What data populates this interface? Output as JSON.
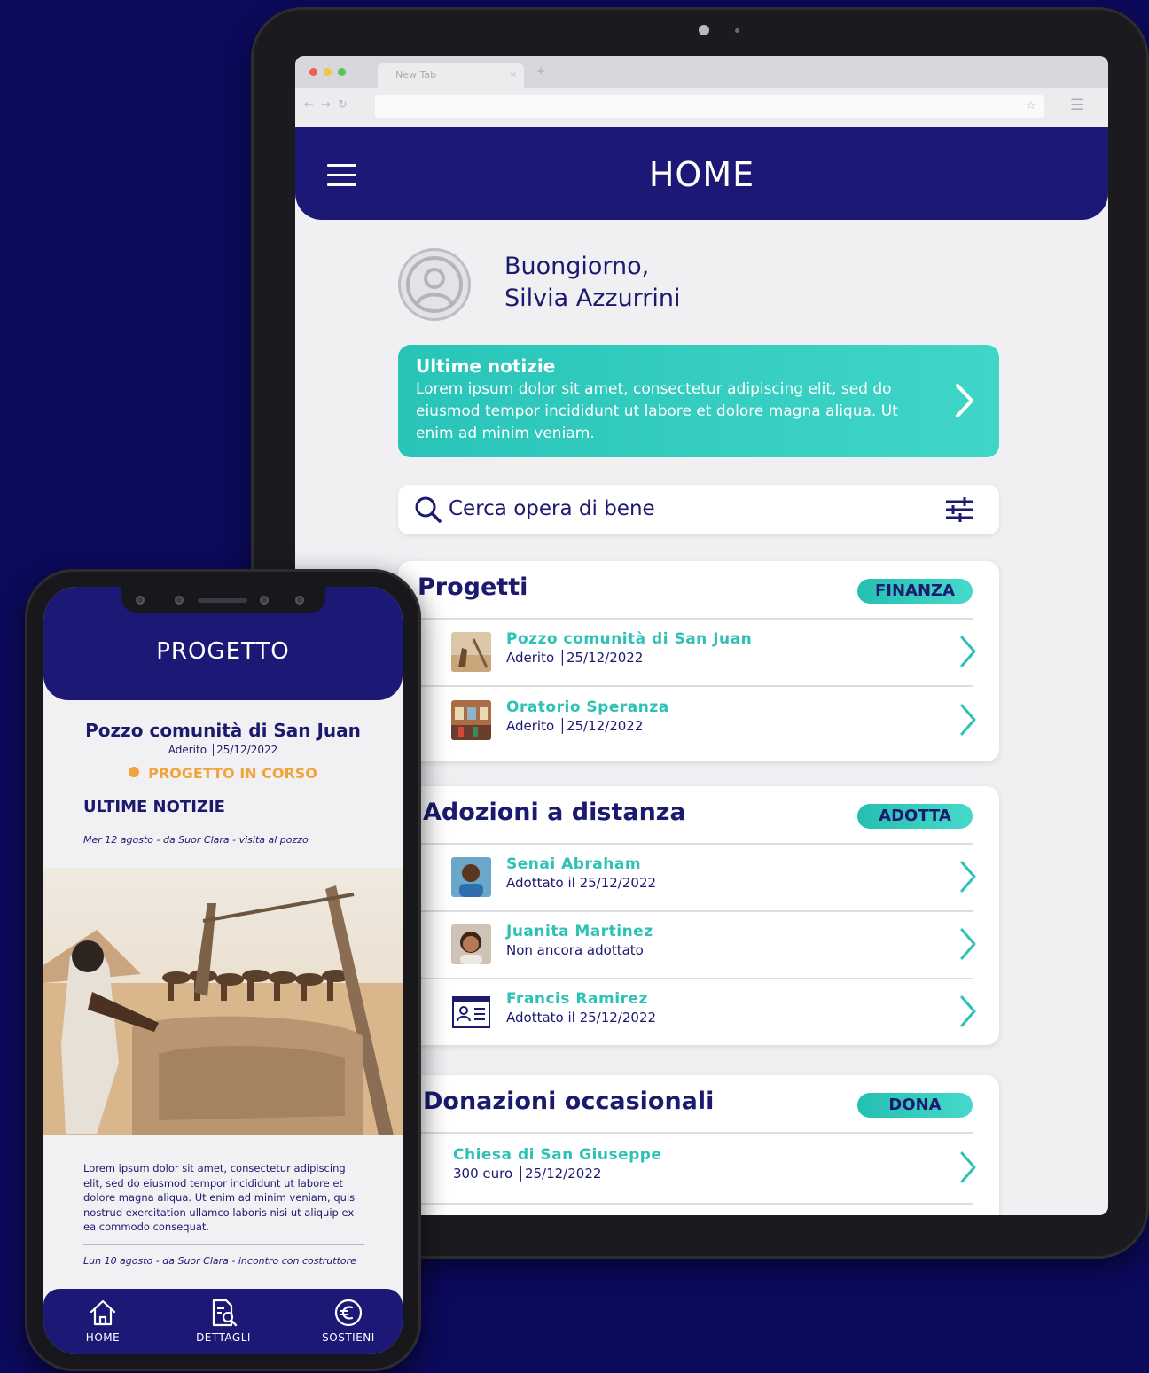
{
  "tablet": {
    "browser": {
      "tab_label": "New Tab",
      "tab_close": "×",
      "new_tab": "+",
      "nav_arrows": "← → ↻",
      "star_icon": "☆",
      "menu_icon": "☰"
    },
    "header": {
      "title": "HOME"
    },
    "greeting": {
      "line1": "Buongiorno,",
      "line2": "Silvia Azzurrini"
    },
    "news": {
      "title": "Ultime notizie",
      "body": "Lorem ipsum dolor sit amet, consectetur adipiscing elit, sed do eiusmod tempor incididunt ut labore et dolore magna aliqua. Ut enim ad minim veniam."
    },
    "search": {
      "placeholder": "Cerca opera di bene"
    },
    "sections": {
      "progetti": {
        "title": "Progetti",
        "pill": "FINANZA",
        "rows": [
          {
            "title": "Pozzo comunità di San Juan",
            "sub": "Aderito │25/12/2022",
            "dot_color": "#f5a03a"
          },
          {
            "title": "Oratorio Speranza",
            "sub": "Aderito │25/12/2022",
            "dot_color": "#3ec55a"
          }
        ]
      },
      "adozioni": {
        "title": "Adozioni a distanza",
        "pill": "ADOTTA",
        "rows": [
          {
            "title": "Senai Abraham",
            "sub": "Adottato il 25/12/2022",
            "dot_color": "#3ec55a"
          },
          {
            "title": "Juanita Martinez",
            "sub": "Non ancora adottato",
            "dot_color": "#f5a03a"
          },
          {
            "title": "Francis Ramirez",
            "sub": "Adottato il 25/12/2022",
            "dot_color": "#f5a03a"
          }
        ]
      },
      "donazioni": {
        "title": "Donazioni occasionali",
        "pill": "DONA",
        "rows": [
          {
            "title": "Chiesa di San Giuseppe",
            "sub": "300 euro │25/12/2022",
            "dot_color": "#f5a03a"
          }
        ]
      }
    }
  },
  "phone": {
    "header": {
      "title": "PROGETTO"
    },
    "project": {
      "title": "Pozzo comunità di San Juan",
      "sub": "Aderito │25/12/2022",
      "status": "PROGETTO IN CORSO"
    },
    "section_title": "ULTIME NOTIZIE",
    "news1_meta": "Mer 12 agosto - da Suor Clara - visita al pozzo",
    "news1_body": "Lorem ipsum dolor sit amet, consectetur adipiscing elit, sed do eiusmod tempor incididunt ut labore et dolore magna aliqua. Ut enim ad minim veniam, quis nostrud exercitation ullamco laboris nisi ut aliquip ex ea commodo consequat.",
    "news2_meta": "Lun 10 agosto - da Suor Clara - incontro con costruttore",
    "nav": {
      "home": "HOME",
      "details": "DETTAGLI",
      "support": "SOSTIENI"
    }
  },
  "colors": {
    "navy": "#1c1876",
    "teal": "#2ec1b5",
    "orange": "#f5a03a",
    "green": "#3ec55a",
    "background": "#0c0a5c"
  }
}
